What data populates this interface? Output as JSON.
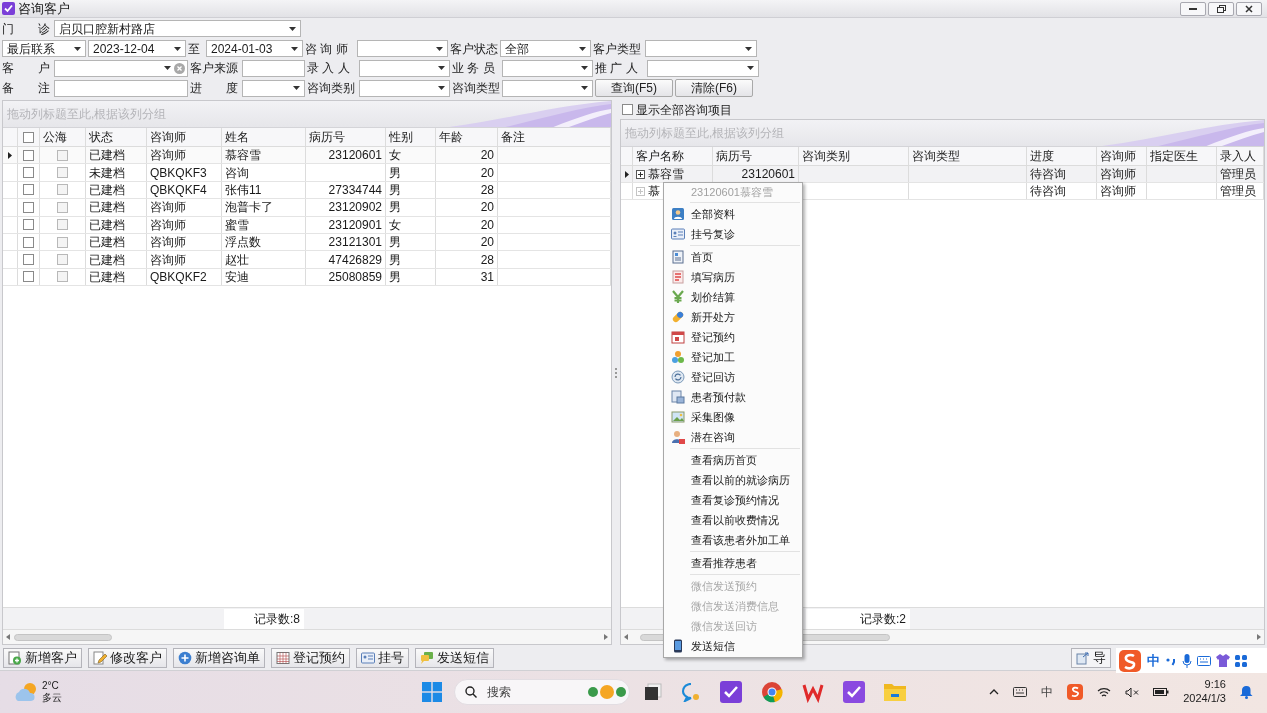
{
  "window": {
    "title": "咨询客户"
  },
  "filters": {
    "rows": [
      [
        {
          "kind": "label",
          "text": "门　　诊"
        },
        {
          "kind": "combo",
          "value": "启贝口腔新村路店"
        }
      ],
      [
        {
          "kind": "combo",
          "value": "最后联系"
        },
        {
          "kind": "combo",
          "value": "2023-12-04"
        },
        {
          "kind": "label",
          "text": "至"
        },
        {
          "kind": "combo",
          "value": "2024-01-03"
        },
        {
          "kind": "label",
          "text": "咨 询 师"
        },
        {
          "kind": "combo"
        },
        {
          "kind": "label",
          "text": "客户状态"
        },
        {
          "kind": "combo",
          "value": "全部"
        },
        {
          "kind": "label",
          "text": "客户类型"
        },
        {
          "kind": "combo"
        }
      ],
      [
        {
          "kind": "label",
          "text": "客　　户"
        },
        {
          "kind": "clearable"
        },
        {
          "kind": "label",
          "text": "客户来源"
        },
        {
          "kind": "input"
        },
        {
          "kind": "label",
          "text": "录 入 人"
        },
        {
          "kind": "combo"
        },
        {
          "kind": "label",
          "text": "业 务 员"
        },
        {
          "kind": "combo"
        },
        {
          "kind": "label",
          "text": "推 广 人"
        },
        {
          "kind": "combo"
        }
      ],
      [
        {
          "kind": "label",
          "text": "备　　注"
        },
        {
          "kind": "input"
        },
        {
          "kind": "label",
          "text": "进　　度"
        },
        {
          "kind": "combo"
        },
        {
          "kind": "label",
          "text": "咨询类别"
        },
        {
          "kind": "combo"
        },
        {
          "kind": "label",
          "text": "咨询类型"
        },
        {
          "kind": "combo"
        },
        {
          "kind": "button",
          "text": "查询(F5)"
        },
        {
          "kind": "button",
          "text": "清除(F6)"
        }
      ]
    ]
  },
  "left_grid": {
    "group_hint": "拖动列标题至此,根据该列分组",
    "all_checked": false,
    "columns": [
      "公海",
      "状态",
      "咨询师",
      "姓名",
      "病历号",
      "性别",
      "年龄",
      "备注"
    ],
    "rows": [
      {
        "current": true,
        "checked": false,
        "public": false,
        "status": "已建档",
        "consultant": "咨询师",
        "name": "慕容雪",
        "record_no": "23120601",
        "gender": "女",
        "age": "20"
      },
      {
        "current": false,
        "checked": false,
        "public": false,
        "status": "未建档",
        "consultant": "QBKQKF3",
        "name": "咨询",
        "gender": "男",
        "age": "20"
      },
      {
        "current": false,
        "checked": false,
        "public": false,
        "status": "已建档",
        "consultant": "QBKQKF4",
        "name": "张伟11",
        "record_no": "27334744",
        "gender": "男",
        "age": "28"
      },
      {
        "current": false,
        "checked": false,
        "public": false,
        "status": "已建档",
        "consultant": "咨询师",
        "name": "泡普卡了",
        "record_no": "23120902",
        "gender": "男",
        "age": "20"
      },
      {
        "current": false,
        "checked": false,
        "public": false,
        "status": "已建档",
        "consultant": "咨询师",
        "name": "蜜雪",
        "record_no": "23120901",
        "gender": "女",
        "age": "20"
      },
      {
        "current": false,
        "checked": false,
        "public": false,
        "status": "已建档",
        "consultant": "咨询师",
        "name": "浮点数",
        "record_no": "23121301",
        "gender": "男",
        "age": "20"
      },
      {
        "current": false,
        "checked": false,
        "public": false,
        "status": "已建档",
        "consultant": "咨询师",
        "name": "赵壮",
        "record_no": "47426829",
        "gender": "男",
        "age": "28"
      },
      {
        "current": false,
        "checked": false,
        "public": false,
        "status": "已建档",
        "consultant": "QBKQKF2",
        "name": "安迪",
        "record_no": "25080859",
        "gender": "男",
        "age": "31"
      }
    ],
    "record_count": "记录数:8"
  },
  "right_grid": {
    "show_all": {
      "label": "显示全部咨询项目",
      "checked": false
    },
    "group_hint": "拖动列标题至此,根据该列分组",
    "columns": [
      "客户名称",
      "病历号",
      "咨询类别",
      "咨询类型",
      "进度",
      "咨询师",
      "指定医生",
      "录入人"
    ],
    "rows": [
      {
        "current": true,
        "expanded": false,
        "name": "慕容雪",
        "record_no": "23120601",
        "progress": "待咨询",
        "consultant": "咨询师",
        "entered_by": "管理员"
      },
      {
        "current": false,
        "expanded": false,
        "name": "慕",
        "progress": "待咨询",
        "consultant": "咨询师",
        "entered_by": "管理员"
      }
    ],
    "record_count": "记录数:2"
  },
  "context_menu": {
    "title": "23120601慕容雪",
    "groups": [
      [
        {
          "kind": "icon",
          "label": "全部资料",
          "disabled": false
        },
        {
          "kind": "icon",
          "label": "挂号复诊",
          "disabled": false
        }
      ],
      [
        {
          "kind": "icon",
          "label": "首页",
          "disabled": false
        },
        {
          "kind": "icon",
          "label": "填写病历",
          "disabled": false
        },
        {
          "kind": "icon",
          "label": "划价结算",
          "disabled": false
        },
        {
          "kind": "icon",
          "label": "新开处方",
          "disabled": false
        },
        {
          "kind": "icon",
          "label": "登记预约",
          "disabled": false
        },
        {
          "kind": "icon",
          "label": "登记加工",
          "disabled": false
        },
        {
          "kind": "icon",
          "label": "登记回访",
          "disabled": false
        },
        {
          "kind": "icon",
          "label": "患者预付款",
          "disabled": false
        },
        {
          "kind": "icon",
          "label": "采集图像",
          "disabled": false
        },
        {
          "kind": "icon",
          "label": "潜在咨询",
          "disabled": false
        }
      ],
      [
        {
          "kind": "text",
          "label": "查看病历首页",
          "disabled": false
        },
        {
          "kind": "text",
          "label": "查看以前的就诊病历",
          "disabled": false
        },
        {
          "kind": "text",
          "label": "查看复诊预约情况",
          "disabled": false
        },
        {
          "kind": "text",
          "label": "查看以前收费情况",
          "disabled": false
        },
        {
          "kind": "text",
          "label": "查看该患者外加工单",
          "disabled": false
        }
      ],
      [
        {
          "kind": "text",
          "label": "查看推荐患者",
          "disabled": false
        }
      ],
      [
        {
          "kind": "text",
          "label": "微信发送预约",
          "disabled": true
        },
        {
          "kind": "text",
          "label": "微信发送消费信息",
          "disabled": true
        },
        {
          "kind": "text",
          "label": "微信发送回访",
          "disabled": true
        },
        {
          "kind": "icon",
          "label": "发送短信",
          "disabled": false
        }
      ]
    ]
  },
  "toolbar": {
    "buttons": [
      {
        "label": "新增客户"
      },
      {
        "label": "修改客户"
      },
      {
        "label": "新增咨询单"
      },
      {
        "label": "登记预约"
      },
      {
        "label": "挂号"
      },
      {
        "label": "发送短信"
      }
    ],
    "right_button": "导"
  },
  "ime_bar": {
    "mode": "中"
  },
  "taskbar": {
    "weather": {
      "temp": "2°C",
      "text": "多云"
    },
    "search_placeholder": "搜索",
    "tray_ime": "中",
    "time": "9:16",
    "date": "2024/1/3"
  }
}
